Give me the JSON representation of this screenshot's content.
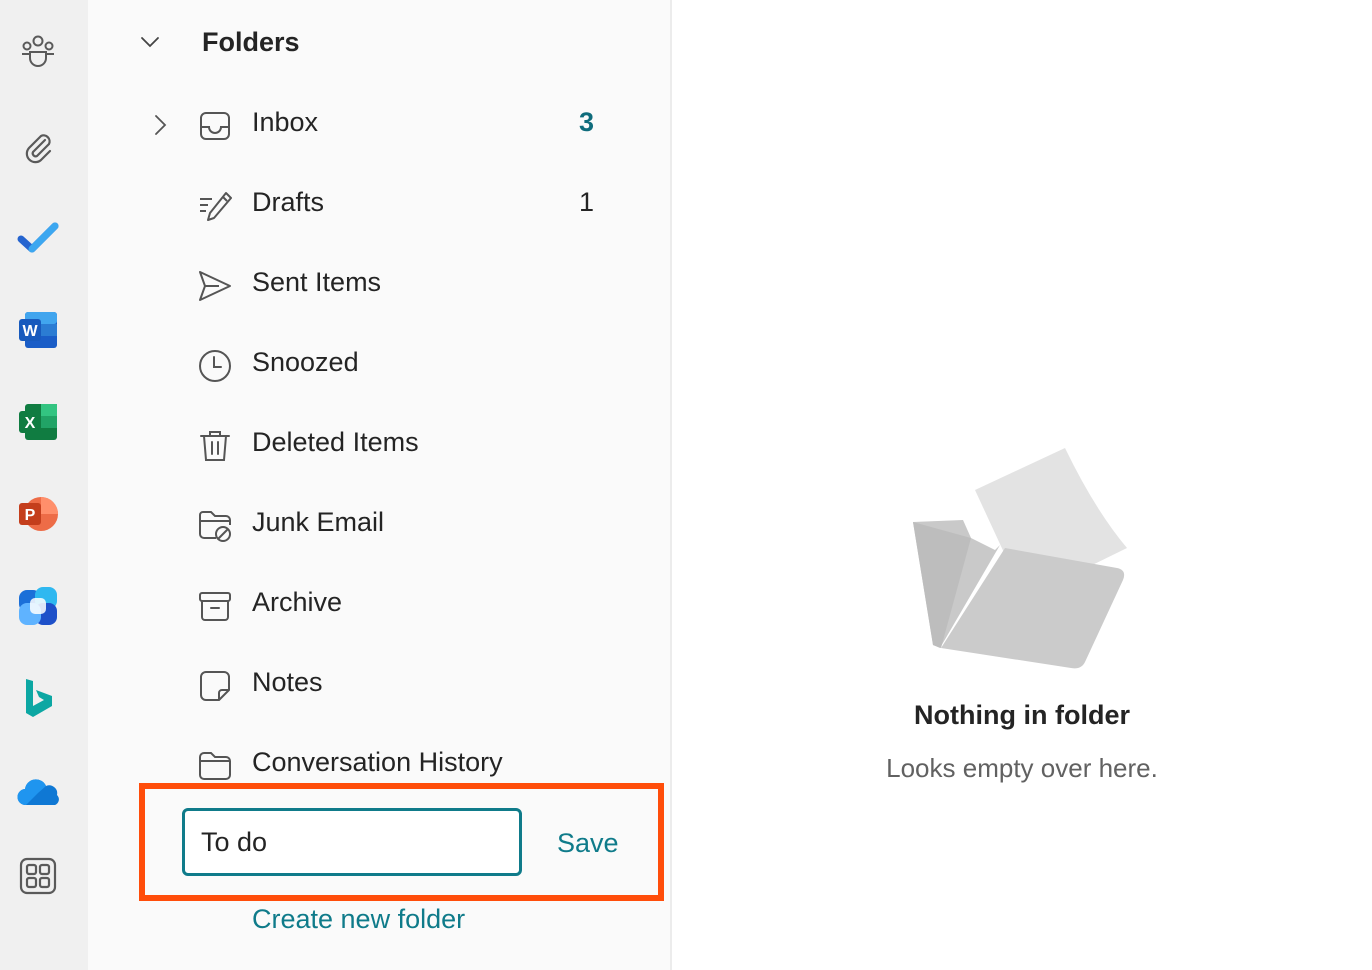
{
  "rail": {
    "apps": [
      {
        "name": "groups",
        "icon": "people-community-icon"
      },
      {
        "name": "files",
        "icon": "paperclip-icon"
      },
      {
        "name": "to-do",
        "icon": "todo-check-icon"
      },
      {
        "name": "word",
        "icon": "word-icon",
        "letter": "W"
      },
      {
        "name": "excel",
        "icon": "excel-icon",
        "letter": "X"
      },
      {
        "name": "powerpoint",
        "icon": "powerpoint-icon",
        "letter": "P"
      },
      {
        "name": "copilot-m365",
        "icon": "m365-icon"
      },
      {
        "name": "bing",
        "icon": "bing-icon"
      },
      {
        "name": "onedrive",
        "icon": "onedrive-icon"
      },
      {
        "name": "more-apps",
        "icon": "apps-grid-icon"
      }
    ]
  },
  "folders": {
    "header": "Folders",
    "items": [
      {
        "label": "Inbox",
        "count": "3",
        "unread": true,
        "icon": "inbox-icon"
      },
      {
        "label": "Drafts",
        "count": "1",
        "unread": false,
        "icon": "drafts-icon"
      },
      {
        "label": "Sent Items",
        "count": "",
        "icon": "send-icon"
      },
      {
        "label": "Snoozed",
        "count": "",
        "icon": "clock-icon"
      },
      {
        "label": "Deleted Items",
        "count": "",
        "icon": "trash-icon"
      },
      {
        "label": "Junk Email",
        "count": "",
        "icon": "junk-folder-icon"
      },
      {
        "label": "Archive",
        "count": "",
        "icon": "archive-icon"
      },
      {
        "label": "Notes",
        "count": "",
        "icon": "note-icon"
      },
      {
        "label": "Conversation History",
        "count": "",
        "icon": "folder-icon"
      }
    ]
  },
  "new_folder": {
    "value": "To do",
    "save_label": "Save",
    "create_link": "Create new folder"
  },
  "empty_state": {
    "title": "Nothing in folder",
    "subtitle": "Looks empty over here."
  },
  "colors": {
    "accent": "#0f7b8a",
    "highlight": "#ff4d0a",
    "unread": "#0f6c7c"
  }
}
